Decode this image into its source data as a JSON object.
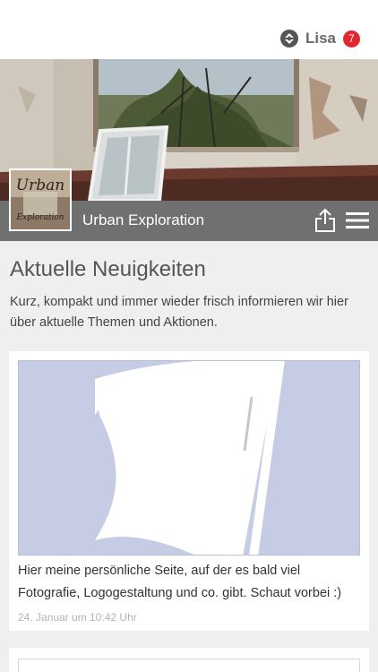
{
  "user": {
    "name": "Lisa",
    "badge": "7",
    "icon": "app-logo-icon"
  },
  "app": {
    "title": "Urban Exploration",
    "logo_text_1": "Urban",
    "logo_text_2": "Exploration"
  },
  "toolbar": {
    "share_icon": "share-icon",
    "menu_icon": "hamburger-menu-icon"
  },
  "news": {
    "heading": "Aktuelle Neuigkeiten",
    "intro": "Kurz, kompakt und immer wieder frisch informieren wir hier über aktuelle Themen und Aktionen.",
    "posts": [
      {
        "image_icon": "flag-placeholder-icon",
        "text": "Hier meine persönliche Seite, auf der es bald viel Fotografie, Logogestaltung und co. gibt. Schaut vorbei :)",
        "date": "24. Januar um 10:42 Uhr"
      }
    ]
  },
  "colors": {
    "badge": "#e3262f",
    "titlebar": "#707070",
    "placeholder": "#c5cce4"
  }
}
